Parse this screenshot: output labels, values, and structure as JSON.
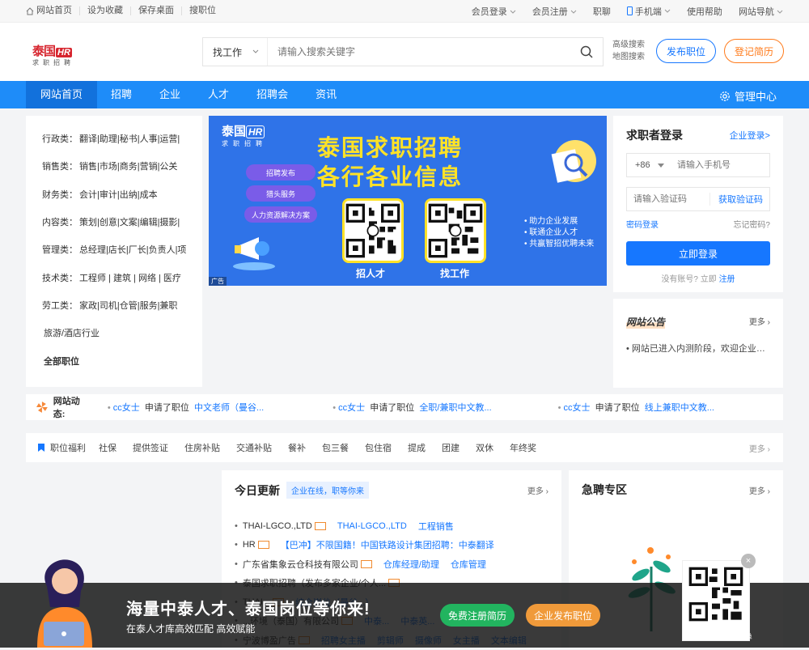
{
  "topbar": {
    "left": [
      "网站首页",
      "设为收藏",
      "保存桌面",
      "搜职位"
    ],
    "right": [
      "会员登录",
      "会员注册",
      "职聊",
      "手机端",
      "使用帮助",
      "网站导航"
    ]
  },
  "logo": {
    "cn": "泰国",
    "hr": "HR",
    "sub": "求职招聘"
  },
  "search": {
    "select": "找工作",
    "placeholder": "请输入搜索关键字",
    "adv1": "高级搜索",
    "adv2": "地图搜索"
  },
  "buttons": {
    "publish": "发布职位",
    "resume": "登记简历"
  },
  "nav": {
    "items": [
      "网站首页",
      "招聘",
      "企业",
      "人才",
      "招聘会",
      "资讯"
    ],
    "manage": "管理中心"
  },
  "categories": [
    {
      "k": "行政类：",
      "v": "翻译|助理|秘书|人事|运营|"
    },
    {
      "k": "销售类：",
      "v": "销售|市场|商务|营销|公关"
    },
    {
      "k": "财务类：",
      "v": "会计|审计|出纳|成本"
    },
    {
      "k": "内容类：",
      "v": "策划|创意|文案|编辑|摄影|"
    },
    {
      "k": "管理类：",
      "v": "总经理|店长|厂长|负责人|项"
    },
    {
      "k": "技术类：",
      "v": "工程师 | 建筑 | 网络 | 医疗"
    },
    {
      "k": "劳工类：",
      "v": "家政|司机|仓管|服务|兼职"
    },
    {
      "k": "",
      "v": "旅游/酒店行业"
    },
    {
      "k": "",
      "v": "全部职位"
    }
  ],
  "banner": {
    "logo": "泰国",
    "hr": "HR",
    "sub": "求职招聘",
    "title1": "泰国求职招聘",
    "title2": "各行各业信息",
    "pills": [
      "招聘发布",
      "猎头服务",
      "人力资源解决方案"
    ],
    "qr1": "招人才",
    "qr2": "找工作",
    "features": [
      "• 助力企业发展",
      "• 联通企业人才",
      "• 共赢智招优聘未来"
    ],
    "ad": "广告"
  },
  "login": {
    "title": "求职者登录",
    "company": "企业登录>",
    "code": "+86",
    "phone_ph": "请输入手机号",
    "vcode_ph": "请输入验证码",
    "get_code": "获取验证码",
    "pwd_login": "密码登录",
    "forgot": "忘记密码?",
    "submit": "立即登录",
    "no_acc": "没有账号? 立即",
    "register": "注册"
  },
  "notice": {
    "title": "网站公告",
    "more": "更多",
    "item": "网站已进入内测阶段，欢迎企业主..."
  },
  "dynamic": {
    "label": "网站动态:",
    "items": [
      {
        "u": "cc女士",
        "a": "申请了职位",
        "j": "中文老师（曼谷..."
      },
      {
        "u": "cc女士",
        "a": "申请了职位",
        "j": "全职/兼职中文教..."
      },
      {
        "u": "cc女士",
        "a": "申请了职位",
        "j": "线上兼职中文教..."
      }
    ]
  },
  "welfare": {
    "label": "职位福利",
    "items": [
      "社保",
      "提供签证",
      "住房补贴",
      "交通补贴",
      "餐补",
      "包三餐",
      "包住宿",
      "提成",
      "团建",
      "双休",
      "年终奖"
    ],
    "more": "更多"
  },
  "today": {
    "title": "今日更新",
    "tag": "企业在线，职等你来",
    "more": "更多",
    "rows": [
      {
        "co": "THAI-LGCO.,LTD",
        "jobs": [
          "THAI-LGCO.,LTD",
          "工程销售"
        ]
      },
      {
        "co": "HR",
        "jobs": [
          "【巴冲】不限国籍！中国铁路设计集团招聘：中泰翻译"
        ]
      },
      {
        "co": "广东省集象云仓科技有限公司",
        "jobs": [
          "仓库经理/助理",
          "仓库管理"
        ]
      },
      {
        "co": "泰国求职招聘（发布多家企业/个人...",
        "jobs": []
      },
      {
        "co": "THAI...",
        "jobs": [
          "综合岗位（曼谷...）"
        ]
      },
      {
        "co": "...环境（泰国）有限公司",
        "jobs": [
          "中泰...",
          "中泰英..."
        ]
      },
      {
        "co": "宁波博盈广告",
        "jobs": [
          "招聘女主播",
          "剪辑师",
          "摄像师",
          "女主播",
          "文本编辑"
        ]
      }
    ]
  },
  "urgent": {
    "title": "急聘专区",
    "more": "更多"
  },
  "floatbar": {
    "title": "海量中泰人才、泰国岗位等你来!",
    "sub": "在泰人才库高效匹配 高效赋能",
    "btn1": "免费注册简历",
    "btn2": "企业发布职位",
    "qr_caption": "微信扫码 求职更简单",
    "close": "×"
  },
  "colors": {
    "primary": "#1e8cf9",
    "brand_red": "#d7262f",
    "orange": "#ff7a1a"
  }
}
